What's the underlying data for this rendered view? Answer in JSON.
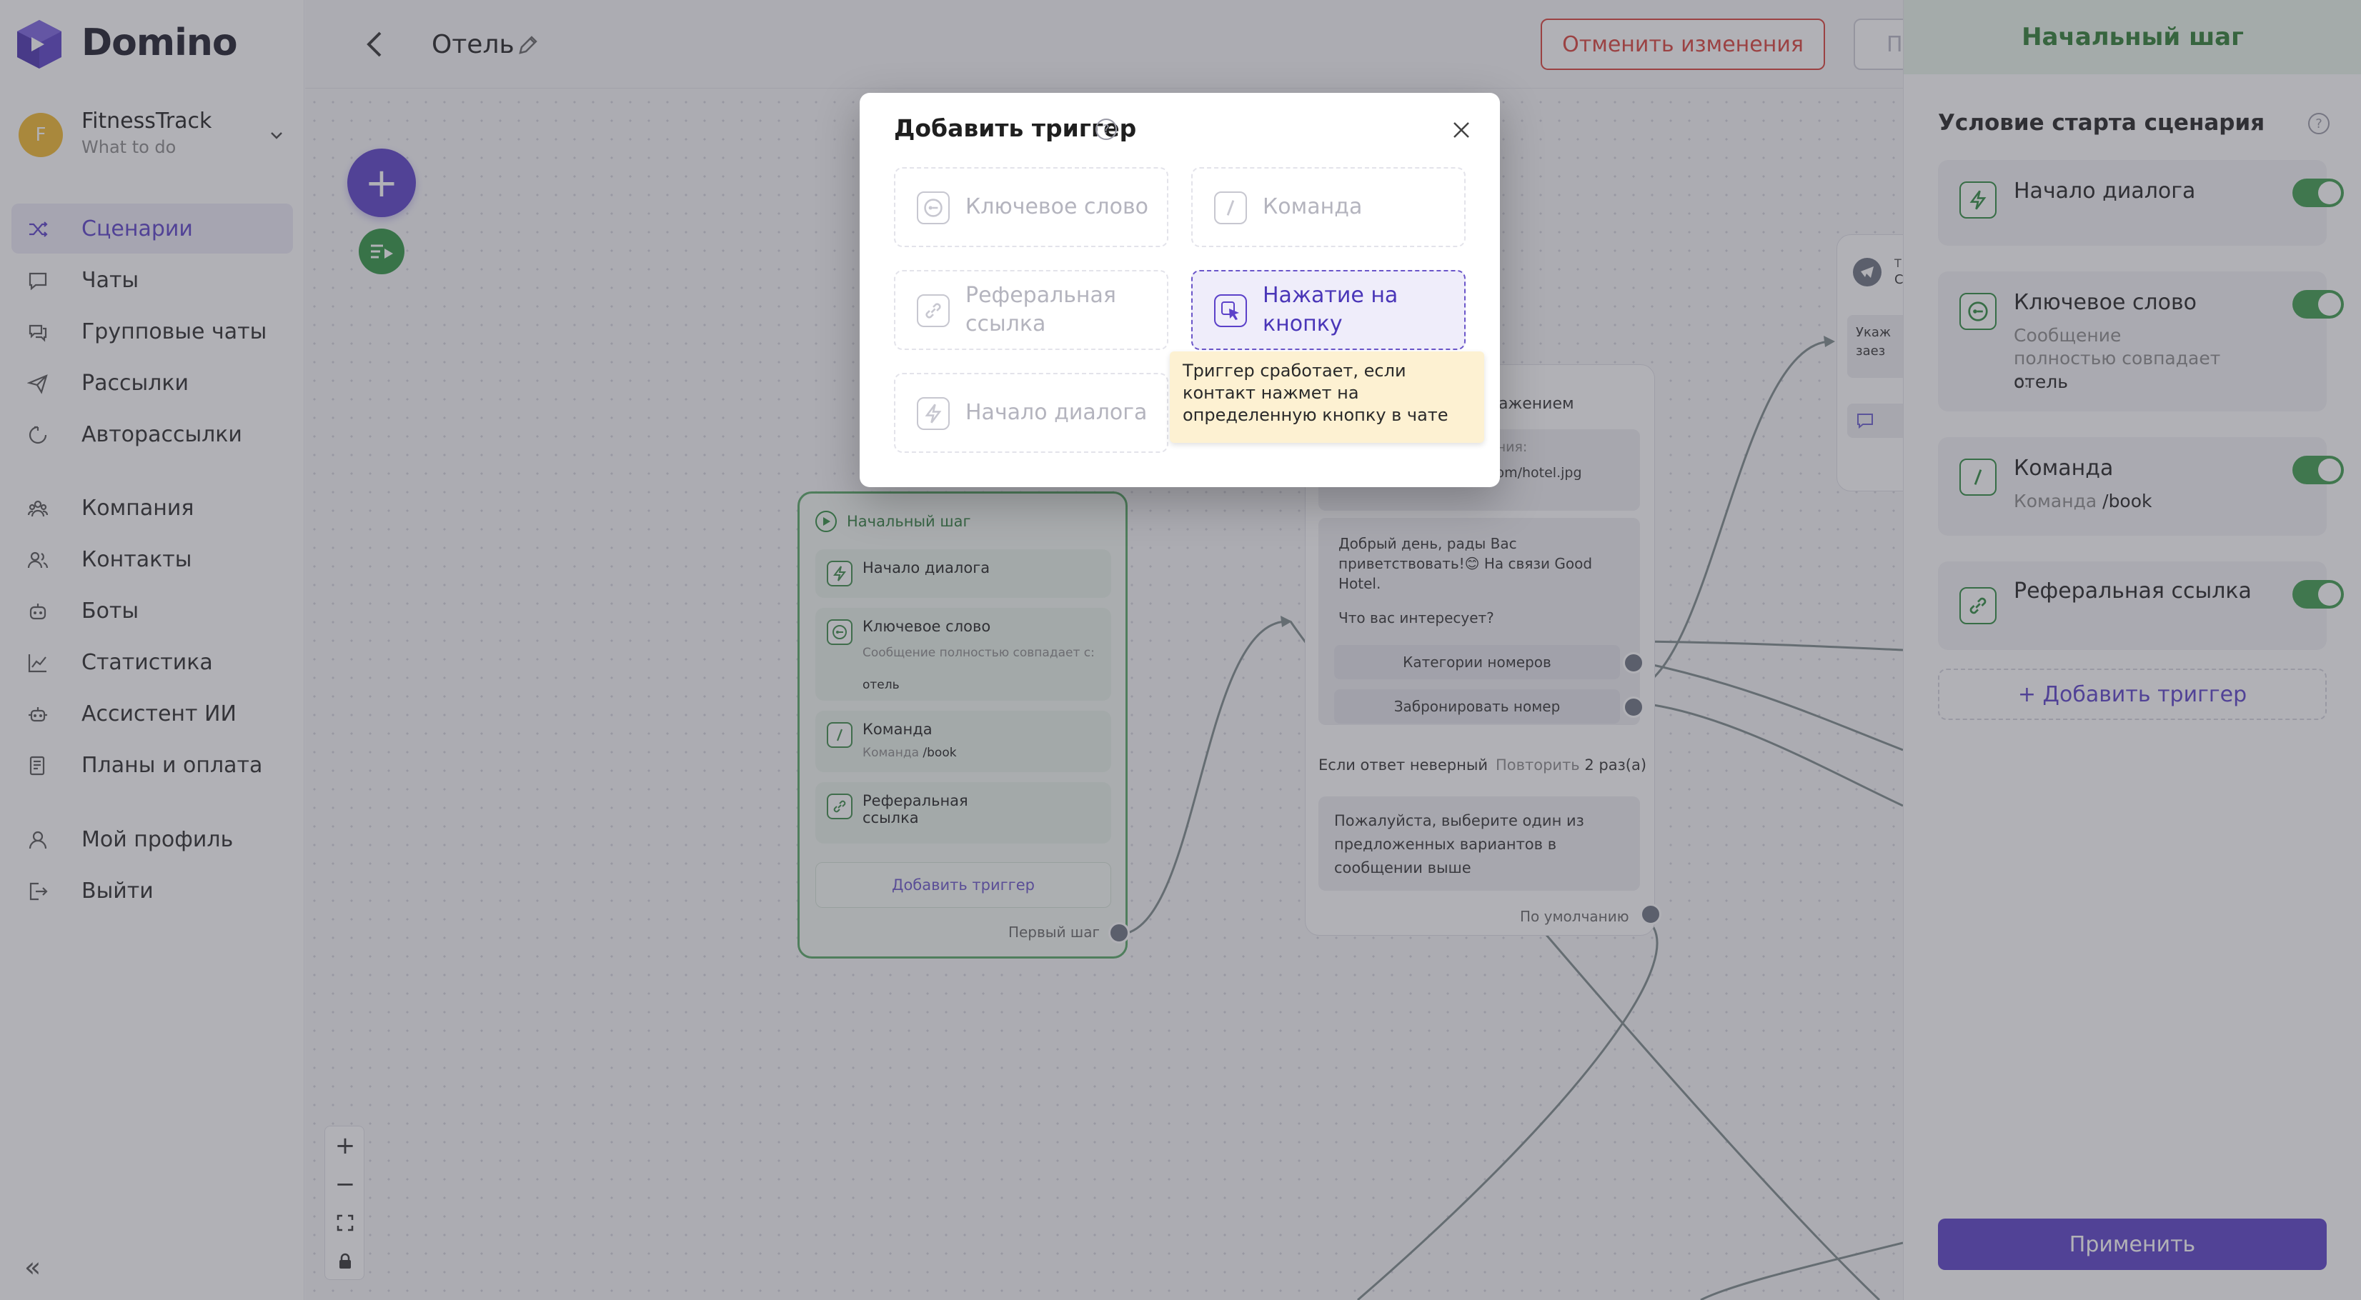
{
  "app": {
    "name": "Domino"
  },
  "workspace": {
    "avatar_letter": "F",
    "name": "FitnessTrack",
    "subtitle": "What to do"
  },
  "nav": [
    {
      "label": "Сценарии",
      "icon": "shuffle-icon",
      "active": true
    },
    {
      "label": "Чаты",
      "icon": "chat-icon"
    },
    {
      "label": "Групповые чаты",
      "icon": "group-chat-icon"
    },
    {
      "label": "Рассылки",
      "icon": "send-icon"
    },
    {
      "label": "Авторассылки",
      "icon": "auto-send-icon"
    },
    {
      "label": "Компания",
      "icon": "company-icon"
    },
    {
      "label": "Контакты",
      "icon": "contacts-icon"
    },
    {
      "label": "Боты",
      "icon": "bot-icon"
    },
    {
      "label": "Статистика",
      "icon": "stats-icon"
    },
    {
      "label": "Ассистент ИИ",
      "icon": "ai-icon"
    },
    {
      "label": "Планы и оплата",
      "icon": "billing-icon"
    },
    {
      "label": "Мой профиль",
      "icon": "profile-icon"
    },
    {
      "label": "Выйти",
      "icon": "logout-icon"
    }
  ],
  "header": {
    "scenario_title": "Отель",
    "cancel_label": "Отменить изменения",
    "save_label": "П"
  },
  "start_node": {
    "title": "Начальный шаг",
    "items": [
      {
        "title": "Начало диалога"
      },
      {
        "title": "Ключевое слово",
        "sub": "Сообщение полностью совпадает с:",
        "value": "отель"
      },
      {
        "title": "Команда",
        "sub": "Команда",
        "value": "/book"
      },
      {
        "title": "Реферальная ссылка"
      }
    ],
    "add_label": "Добавить триггер",
    "first_step_label": "Первый шаг"
  },
  "msg_node": {
    "header_partial": "ражением",
    "image_label_partial": "ения:",
    "image_url_partial": "com/hotel.jpg",
    "greeting": "Добрый день, рады Вас приветствовать!😊 На связи Good Hotel.",
    "question": "Что вас интересует?",
    "choices": [
      "Категории номеров",
      "Забронировать номер"
    ],
    "wrong_label": "Если ответ неверный",
    "repeat_label": "Повторить",
    "repeat_count": "2 раз(а)",
    "fallback_text": "Пожалуйста, выберите один из предложенных вариантов в сообщении выше",
    "default_label": "По умолчанию"
  },
  "tg_node": {
    "line1": "Т",
    "line2": "С",
    "text1": "Укаж",
    "text2": "заез"
  },
  "right_panel": {
    "title": "Начальный шаг",
    "condition_title": "Условие старта сценария",
    "help": "?",
    "triggers": [
      {
        "title": "Начало диалога",
        "enabled": true
      },
      {
        "title": "Ключевое слово",
        "sub": "Сообщение полностью совпадает с:",
        "value": "отель",
        "enabled": true
      },
      {
        "title": "Команда",
        "sub": "Команда",
        "value": "/book",
        "enabled": true
      },
      {
        "title": "Реферальная ссылка",
        "enabled": true
      }
    ],
    "add_label": "+ Добавить триггер",
    "apply_label": "Применить"
  },
  "modal": {
    "title": "Добавить триггер",
    "help": "?",
    "options": [
      {
        "label": "Ключевое слово",
        "icon": "key-chat-icon"
      },
      {
        "label": "Команда",
        "icon": "slash-icon"
      },
      {
        "label": "Реферальная ссылка",
        "icon": "link-icon"
      },
      {
        "label": "Нажатие на кнопку",
        "icon": "cursor-click-icon",
        "selected": true
      },
      {
        "label": "Начало диалога",
        "icon": "lightning-icon"
      }
    ],
    "tooltip": "Триггер сработает, если контакт нажмет на определенную кнопку в чате"
  },
  "colors": {
    "accent": "#5b41c9",
    "green": "#2e8b3e",
    "danger": "#d9413a"
  }
}
